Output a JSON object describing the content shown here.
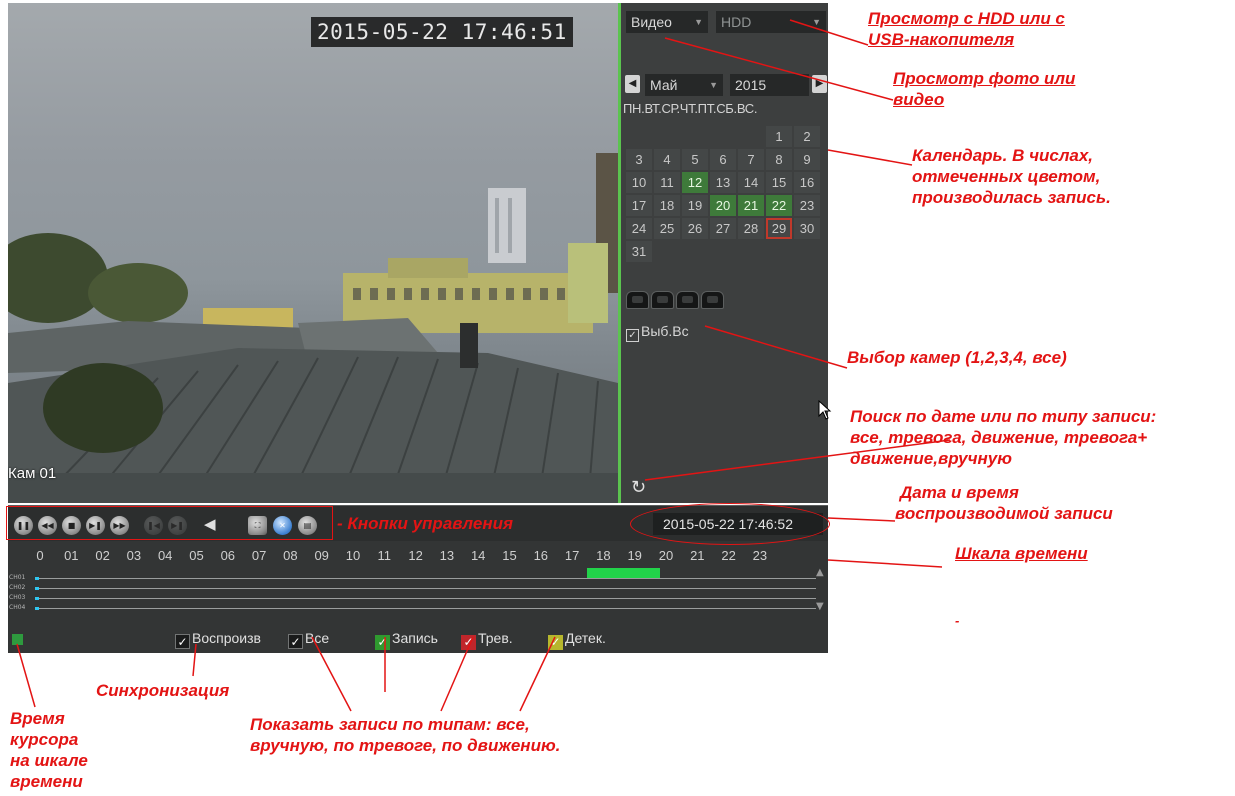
{
  "video": {
    "osd_timestamp": "2015-05-22 17:46:51",
    "camera_label": "Кам 01"
  },
  "panel": {
    "type_dropdown": "Видео",
    "source_dropdown": "HDD",
    "month_dropdown": "Май",
    "year_dropdown": "2015",
    "weekdays": "ПН.ВТ.СР.ЧТ.ПТ.СБ.ВС.",
    "calendar": [
      {
        "d": ""
      },
      {
        "d": ""
      },
      {
        "d": ""
      },
      {
        "d": ""
      },
      {
        "d": ""
      },
      {
        "d": "1"
      },
      {
        "d": "2"
      },
      {
        "d": "3"
      },
      {
        "d": "4"
      },
      {
        "d": "5"
      },
      {
        "d": "6"
      },
      {
        "d": "7"
      },
      {
        "d": "8"
      },
      {
        "d": "9"
      },
      {
        "d": "10"
      },
      {
        "d": "11"
      },
      {
        "d": "12",
        "rec": true
      },
      {
        "d": "13"
      },
      {
        "d": "14"
      },
      {
        "d": "15"
      },
      {
        "d": "16"
      },
      {
        "d": "17"
      },
      {
        "d": "18"
      },
      {
        "d": "19"
      },
      {
        "d": "20",
        "rec": true
      },
      {
        "d": "21",
        "rec": true
      },
      {
        "d": "22",
        "rec": true
      },
      {
        "d": "23"
      },
      {
        "d": "24"
      },
      {
        "d": "25"
      },
      {
        "d": "26"
      },
      {
        "d": "27"
      },
      {
        "d": "28"
      },
      {
        "d": "29",
        "sel": true
      },
      {
        "d": "30"
      },
      {
        "d": "31"
      }
    ],
    "select_all_label": "Выб.Вс",
    "recorded_color": "#3e7a3a",
    "accent_color": "#5bc44f"
  },
  "controls": {
    "datetime": "2015-05-22 17:46:52",
    "icons": [
      "pause-icon",
      "rewind-icon",
      "stop-icon",
      "forward-icon",
      "fast-forward-icon",
      "prev-frame-icon",
      "next-frame-icon",
      "volume-icon",
      "fullscreen-icon",
      "zoom-icon",
      "backup-icon"
    ]
  },
  "timeline": {
    "hours": [
      "0",
      "01",
      "02",
      "03",
      "04",
      "05",
      "06",
      "07",
      "08",
      "09",
      "10",
      "11",
      "12",
      "13",
      "14",
      "15",
      "16",
      "17",
      "18",
      "19",
      "20",
      "21",
      "22",
      "23"
    ],
    "channels": [
      "CH01",
      "CH02",
      "CH03",
      "CH04"
    ],
    "record_color": "#22d34a"
  },
  "filters": {
    "sync": "Воспроизв",
    "all": "Все",
    "record": "Запись",
    "alarm": "Трев.",
    "motion": "Детек."
  },
  "annotations": {
    "storage": [
      "Просмотр с HDD или с",
      "USB-накопителя"
    ],
    "media": [
      "Просмотр фото или",
      "видео"
    ],
    "calendar": [
      "Календарь. В числах,",
      "отмеченных цветом,",
      "производилась запись."
    ],
    "cameras": "Выбор камер (1,2,3,4, все)",
    "search": [
      "Поиск по дате или по типу записи:",
      "все, тревога, движение, тревога+",
      "движение,вручную"
    ],
    "datetime": [
      "Дата и время",
      "воспроизводимой записи"
    ],
    "scale": "Шкала времени",
    "controls": "- Кнопки управления",
    "sync": "Синхронизация",
    "cursor_time": [
      "Время",
      "курсора",
      "на шкале",
      "времени"
    ],
    "types": [
      "Показать записи по типам: все,",
      "вручную, по тревоге, по движению."
    ],
    "dash": "-"
  }
}
